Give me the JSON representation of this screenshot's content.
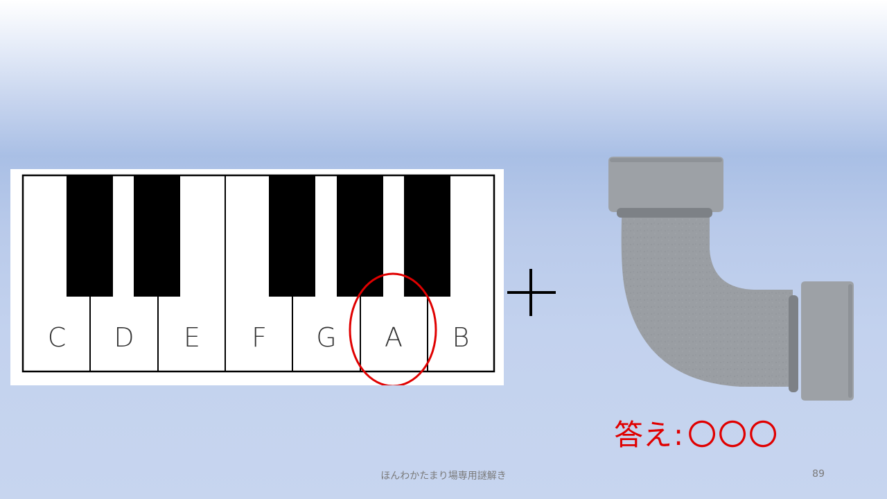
{
  "piano": {
    "keys": [
      "C",
      "D",
      "E",
      "F",
      "G",
      "A",
      "B"
    ],
    "highlighted_key": "A",
    "highlight_color": "#e00000"
  },
  "operator": "+",
  "picture": "pipe-elbow",
  "answer": {
    "label": "答え",
    "separator": ":",
    "placeholder": "〇〇〇",
    "color": "#e00000"
  },
  "footer": {
    "text": "ほんわかたまり場専用謎解き",
    "page_number": "89"
  }
}
